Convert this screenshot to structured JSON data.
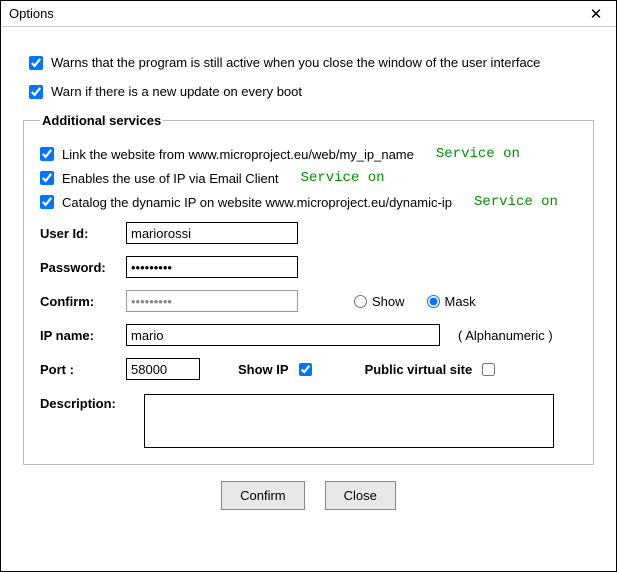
{
  "title": "Options",
  "warn_active_label": "Warns that the program is still active when you close the window of the user interface",
  "warn_active_checked": true,
  "warn_update_label": "Warn if there is a new update on every boot",
  "warn_update_checked": true,
  "group_title": "Additional services",
  "svc": [
    {
      "label": "Link the website from www.microproject.eu/web/my_ip_name",
      "checked": true,
      "status": "Service on"
    },
    {
      "label": "Enables the use of IP via Email Client",
      "checked": true,
      "status": "Service on"
    },
    {
      "label": "Catalog the dynamic IP on website www.microproject.eu/dynamic-ip",
      "checked": true,
      "status": "Service on"
    }
  ],
  "labels": {
    "user": "User Id:",
    "password": "Password:",
    "confirm": "Confirm:",
    "ipname": "IP name:",
    "port": "Port :",
    "showip": "Show IP",
    "publicvs": "Public virtual site",
    "description": "Description:",
    "show": "Show",
    "mask": "Mask",
    "alphahint": "( Alphanumeric )"
  },
  "values": {
    "user": "mariorossi",
    "password": "•••••••••",
    "confirm": "•••••••••",
    "ipname": "mario",
    "port": "58000",
    "showip_checked": true,
    "publicvs_checked": false,
    "mask_selected": "mask",
    "description": ""
  },
  "buttons": {
    "confirm": "Confirm",
    "close": "Close"
  }
}
